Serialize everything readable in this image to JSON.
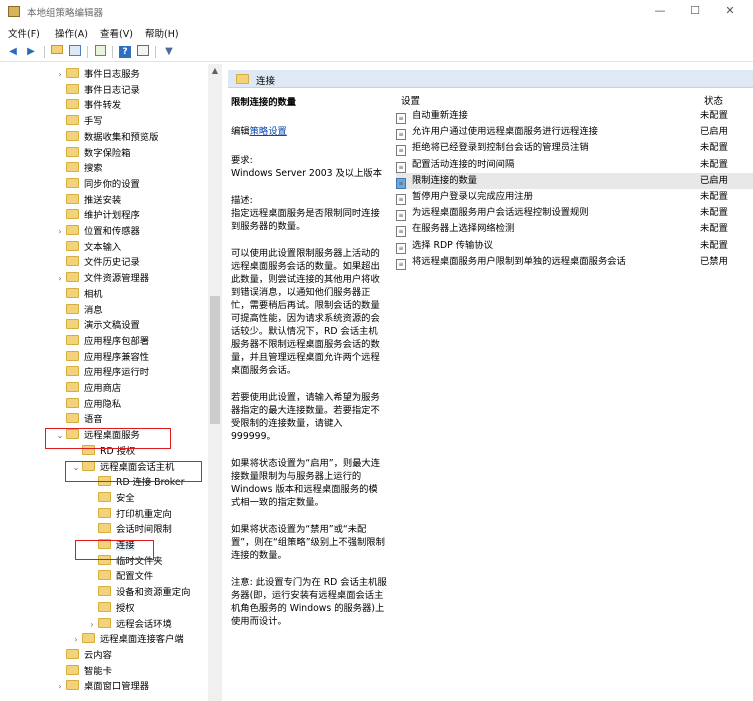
{
  "window": {
    "title": "本地组策略编辑器",
    "minimize": "—",
    "maximize": "☐",
    "close": "✕"
  },
  "menu": [
    "文件(F)",
    "操作(A)",
    "查看(V)",
    "帮助(H)"
  ],
  "toolbar_icons": [
    "back-icon",
    "forward-icon",
    "folder-up-icon",
    "show-tree-icon",
    "export-icon",
    "help-icon",
    "properties-icon",
    "filter-icon"
  ],
  "tree": [
    {
      "label": "事件日志服务",
      "expander": "›"
    },
    {
      "label": "事件日志记录",
      "expander": ""
    },
    {
      "label": "事件转发",
      "expander": ""
    },
    {
      "label": "手写",
      "expander": ""
    },
    {
      "label": "数据收集和预览版",
      "expander": ""
    },
    {
      "label": "数字保险箱",
      "expander": ""
    },
    {
      "label": "搜索",
      "expander": ""
    },
    {
      "label": "同步你的设置",
      "expander": ""
    },
    {
      "label": "推送安装",
      "expander": ""
    },
    {
      "label": "维护计划程序",
      "expander": ""
    },
    {
      "label": "位置和传感器",
      "expander": "›"
    },
    {
      "label": "文本输入",
      "expander": ""
    },
    {
      "label": "文件历史记录",
      "expander": ""
    },
    {
      "label": "文件资源管理器",
      "expander": "›"
    },
    {
      "label": "相机",
      "expander": ""
    },
    {
      "label": "消息",
      "expander": ""
    },
    {
      "label": "演示文稿设置",
      "expander": ""
    },
    {
      "label": "应用程序包部署",
      "expander": ""
    },
    {
      "label": "应用程序兼容性",
      "expander": ""
    },
    {
      "label": "应用程序运行时",
      "expander": ""
    },
    {
      "label": "应用商店",
      "expander": ""
    },
    {
      "label": "应用隐私",
      "expander": ""
    },
    {
      "label": "语音",
      "expander": ""
    },
    {
      "label": "远程桌面服务",
      "expander": "⌄"
    },
    {
      "label": "RD 授权",
      "expander": ""
    },
    {
      "label": "远程桌面会话主机",
      "expander": "⌄"
    },
    {
      "label": "RD 连接 Broker",
      "expander": ""
    },
    {
      "label": "安全",
      "expander": ""
    },
    {
      "label": "打印机重定向",
      "expander": ""
    },
    {
      "label": "会话时间限制",
      "expander": ""
    },
    {
      "label": "连接",
      "expander": ""
    },
    {
      "label": "临时文件夹",
      "expander": ""
    },
    {
      "label": "配置文件",
      "expander": ""
    },
    {
      "label": "设备和资源重定向",
      "expander": ""
    },
    {
      "label": "授权",
      "expander": ""
    },
    {
      "label": "远程会话环境",
      "expander": "›"
    },
    {
      "label": "远程桌面连接客户端",
      "expander": "›"
    },
    {
      "label": "云内容",
      "expander": ""
    },
    {
      "label": "智能卡",
      "expander": ""
    },
    {
      "label": "桌面窗口管理器",
      "expander": "›"
    }
  ],
  "tree_scroll_up": "▲",
  "header": {
    "title": "连接"
  },
  "description": {
    "title": "限制连接的数量",
    "edit_prefix": "编辑",
    "edit_link": "策略设置",
    "requirements_label": "要求:",
    "requirements_value": "Windows Server 2003 及以上版本",
    "desc_label": "描述:",
    "desc_text": "指定远程桌面服务是否限制同时连接到服务器的数量。",
    "para1": "可以使用此设置限制服务器上活动的远程桌面服务会话的数量。如果超出此数量，则尝试连接的其他用户将收到错误消息，以通知他们服务器正忙，需要稍后再试。限制会话的数量可提高性能，因为请求系统资源的会话较少。默认情况下，RD 会话主机服务器不限制远程桌面服务会话的数量，并且管理远程桌面允许两个远程桌面服务会话。",
    "para2": "若要使用此设置，请输入希望为服务器指定的最大连接数量。若要指定不受限制的连接数量，请键入 999999。",
    "para3": "如果将状态设置为“启用”，则最大连接数量限制为与服务器上运行的 Windows 版本和远程桌面服务的模式相一致的指定数量。",
    "para4": "如果将状态设置为“禁用”或“未配置”，则在“组策略”级别上不强制限制连接的数量。",
    "para5": "注意: 此设置专门为在 RD 会话主机服务器(即，运行安装有远程桌面会话主机角色服务的 Windows 的服务器)上使用而设计。"
  },
  "list": {
    "col_setting": "设置",
    "col_state": "状态",
    "rows": [
      {
        "name": "自动重新连接",
        "state": "未配置"
      },
      {
        "name": "允许用户通过使用远程桌面服务进行远程连接",
        "state": "已启用"
      },
      {
        "name": "拒绝将已经登录到控制台会话的管理员注销",
        "state": "未配置"
      },
      {
        "name": "配置活动连接的时间间隔",
        "state": "未配置"
      },
      {
        "name": "限制连接的数量",
        "state": "已启用"
      },
      {
        "name": "暂停用户登录以完成应用注册",
        "state": "未配置"
      },
      {
        "name": "为远程桌面服务用户会话远程控制设置规则",
        "state": "未配置"
      },
      {
        "name": "在服务器上选择网络检测",
        "state": "未配置"
      },
      {
        "name": "选择 RDP 传输协议",
        "state": "未配置"
      },
      {
        "name": "将远程桌面服务用户限制到单独的远程桌面服务会话",
        "state": "已禁用"
      }
    ]
  }
}
